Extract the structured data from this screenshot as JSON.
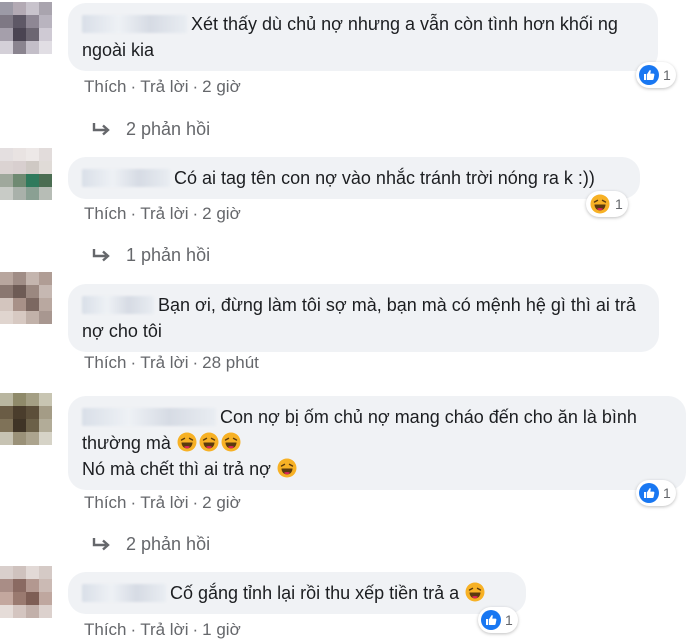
{
  "comments": [
    {
      "text": "Xét thấy dù chủ nợ nhưng a vẫn còn tình hơn khối ng ngoài kia",
      "like_label": "Thích",
      "reply_label": "Trả lời",
      "time": "2 giờ",
      "reaction_icon": "like-icon",
      "reaction_count": "1",
      "replies_text": "2 phản hồi"
    },
    {
      "text": "Có ai tag tên con nợ vào nhắc tránh trời nóng ra k :))",
      "like_label": "Thích",
      "reply_label": "Trả lời",
      "time": "2 giờ",
      "reaction_icon": "haha-icon",
      "reaction_count": "1",
      "replies_text": "1 phản hồi"
    },
    {
      "text": "Bạn ơi, đừng làm tôi sợ mà, bạn mà có mệnh hệ gì thì ai trả nợ cho tôi",
      "like_label": "Thích",
      "reply_label": "Trả lời",
      "time": "28 phút"
    },
    {
      "text_line1": "Con nợ bị ốm chủ nợ mang cháo đến cho ăn là bình",
      "text_line2": "thường mà",
      "text_line3": "Nó mà chết thì ai trả nợ",
      "like_label": "Thích",
      "reply_label": "Trả lời",
      "time": "2 giờ",
      "reaction_icon": "like-icon",
      "reaction_count": "1",
      "replies_text": "2 phản hồi"
    },
    {
      "text": "Cố gắng tỉnh lại rồi thu xếp tiền trả a",
      "like_label": "Thích",
      "reply_label": "Trả lời",
      "time": "1 giờ",
      "reaction_icon": "like-icon",
      "reaction_count": "1"
    }
  ],
  "colors": {
    "bubble": "#f0f2f5",
    "meta": "#65676b",
    "like_blue": "#1877f2",
    "haha_yellow": "#f7b125"
  }
}
